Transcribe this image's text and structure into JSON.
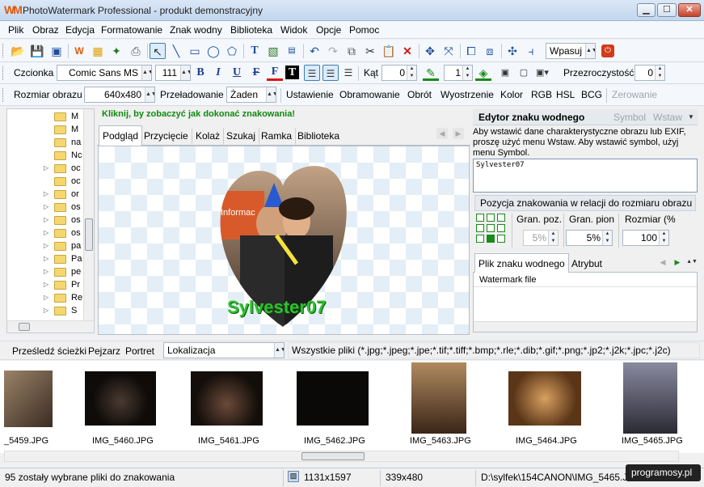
{
  "window": {
    "title": "PhotoWatermark Professional - produkt demonstracyjny",
    "app_icon": "WM",
    "minimize": "▁",
    "maximize": "☐",
    "close": "✕"
  },
  "menu": [
    "Plik",
    "Obraz",
    "Edycja",
    "Formatowanie",
    "Znak wodny",
    "Biblioteka",
    "Widok",
    "Opcje",
    "Pomoc"
  ],
  "toolbar1": {
    "fit_value": "Wpasuj",
    "icons": [
      "open-icon",
      "save-icon",
      "save-watermark-icon",
      "watermark-icon",
      "batch-icon",
      "effects-icon",
      "print-icon",
      "cursor-icon",
      "line-icon",
      "rectangle-icon",
      "ellipse-icon",
      "shape-icon",
      "text-icon",
      "image-icon",
      "calendar-icon",
      "undo-icon",
      "redo-icon",
      "copy-icon",
      "cut-icon",
      "paste-icon",
      "delete-icon",
      "align-icon",
      "distribute-icon",
      "group-icon",
      "ungroup-icon",
      "move-icon",
      "align-left-icon",
      "stop-icon"
    ]
  },
  "toolbar2": {
    "font_label": "Czcionka",
    "font_value": "Comic Sans MS",
    "size_value": "111",
    "angle_label": "Kąt",
    "angle_value": "0",
    "width_value": "1",
    "transparency_label": "Przezroczystość",
    "transparency_value": "0",
    "format_bold": "B",
    "format_italic": "I",
    "format_underline": "U",
    "format_strike": "F",
    "format_color": "F",
    "format_bg": "T"
  },
  "toolbar3": {
    "size_label": "Rozmiar obrazu",
    "size_value": "640x480",
    "reload_label": "Przeładowanie",
    "reload_value": "Żaden",
    "buttons": [
      "Ustawienie",
      "Obramowanie",
      "Obrót",
      "Wyostrzenie",
      "Kolor",
      "RGB",
      "HSL",
      "BCG",
      "Zerowanie"
    ]
  },
  "tree": {
    "items": [
      "M",
      "M",
      "na",
      "Nc",
      "oc",
      "oc",
      "or",
      "os",
      "os",
      "os",
      "pa",
      "Pa",
      "pe",
      "Pr",
      "Re",
      "S"
    ]
  },
  "center": {
    "hint": "Kliknij, by zobaczyć jak dokonać znakowania!",
    "tabs": [
      "Podgląd",
      "Przycięcie",
      "Kolaż",
      "Szukaj",
      "Ramka",
      "Biblioteka"
    ],
    "active_tab": "Podgląd",
    "watermark_text": "Sylvester07"
  },
  "editor": {
    "title": "Edytor znaku wodnego",
    "symbol": "Symbol",
    "insert": "Wstaw",
    "description": "Aby wstawić dane charakterystyczne obrazu lub EXIF, proszę użyć menu Wstaw. Aby wstawić symbol, użyj menu Symbol.",
    "text": "Sylvester07",
    "position_header": "Pozycja znakowania w relacji do rozmiaru obrazu",
    "col_horizontal": "Gran. poz.",
    "col_vertical": "Gran. pion",
    "col_size": "Rozmiar (%",
    "horizontal_value": "5%",
    "vertical_value": "5%",
    "size_value": "100"
  },
  "file_panel": {
    "tabs": [
      "Plik znaku wodnego",
      "Atrybut"
    ],
    "header": "Watermark file"
  },
  "browser_strip": {
    "buttons": [
      "Prześledź ścieżki",
      "Pejzarz",
      "Portret"
    ],
    "location_value": "Lokalizacja",
    "filter": "Wszystkie pliki (*.jpg;*.jpeg;*.jpe;*.tif;*.tiff;*.bmp;*.rle;*.dib;*.gif;*.png;*.jp2;*.j2k;*.jpc;*.j2c)"
  },
  "thumbnails": [
    {
      "name": "_5459.JPG",
      "color": "#6b5a4a"
    },
    {
      "name": "IMG_5460.JPG",
      "color": "#1b1612"
    },
    {
      "name": "IMG_5461.JPG",
      "color": "#2a1e17"
    },
    {
      "name": "IMG_5462.JPG",
      "color": "#0a0908"
    },
    {
      "name": "IMG_5463.JPG",
      "color": "#7b5a3c"
    },
    {
      "name": "IMG_5464.JPG",
      "color": "#a1703a"
    },
    {
      "name": "IMG_5465.JPG",
      "color": "#5f5f73"
    }
  ],
  "status": {
    "selection": "95 zostały wybrane pliki do znakowania",
    "original_size": "1131x1597",
    "current_size": "339x480",
    "path": "D:\\sylfek\\154CANON\\IMG_5465.JP",
    "badge": "programosy.pl"
  }
}
